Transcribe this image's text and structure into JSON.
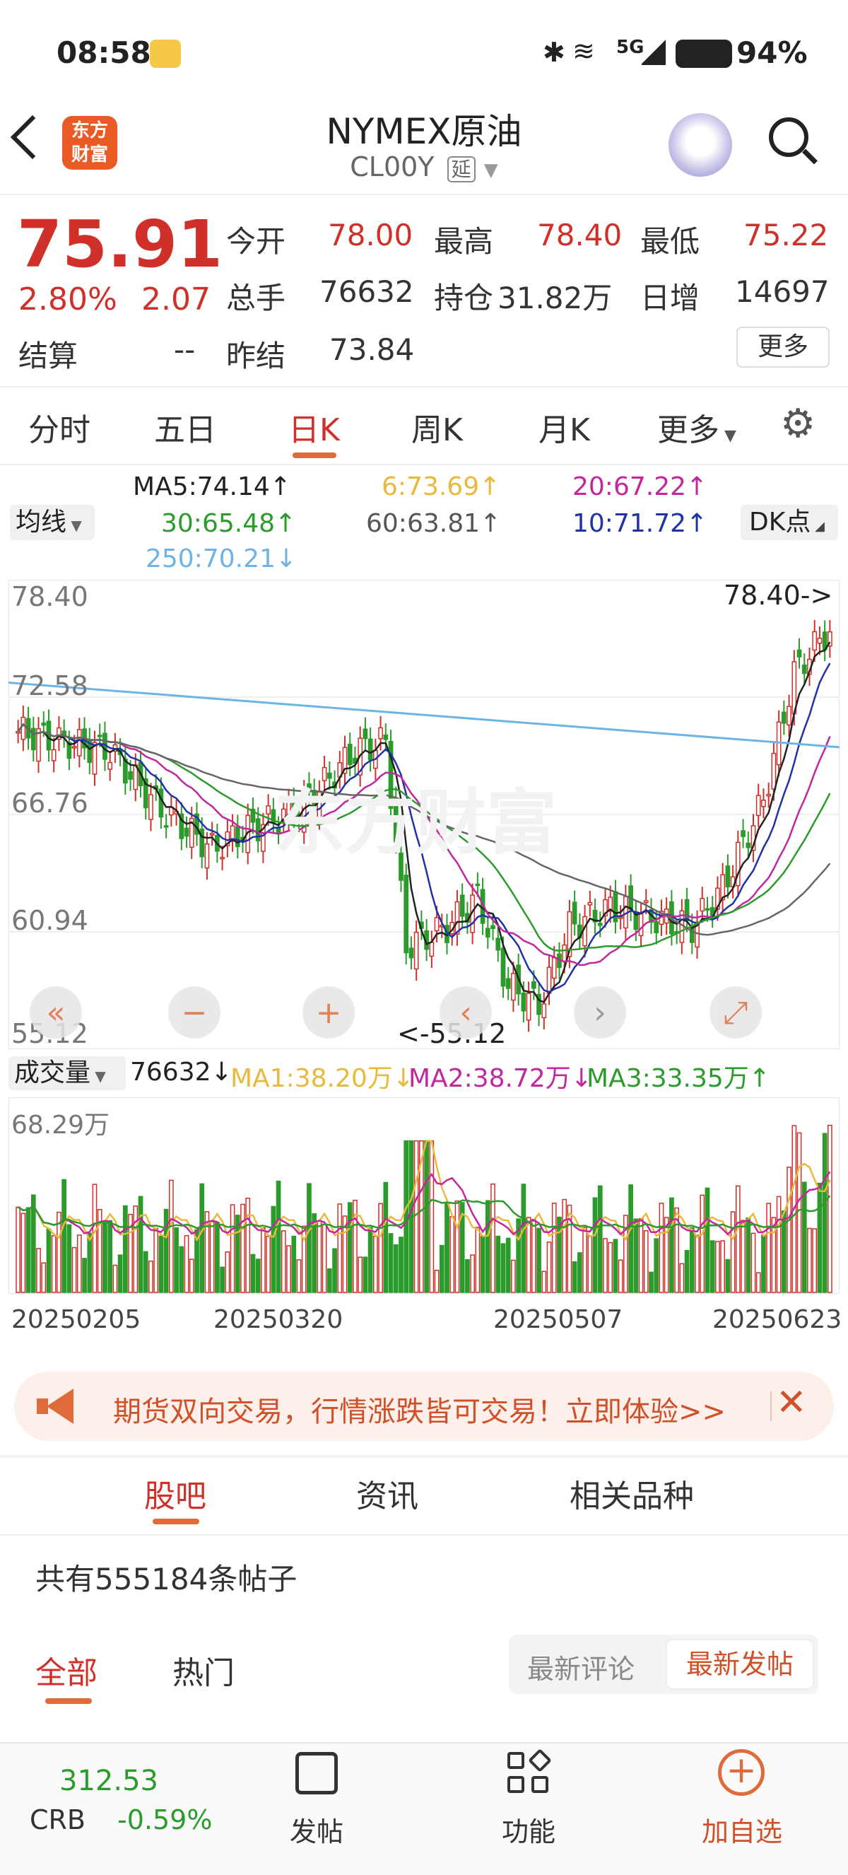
{
  "status": {
    "time": "08:58",
    "signal": "5G",
    "battery": "94%"
  },
  "header": {
    "title": "NYMEX原油",
    "code": "CL00Y",
    "tag": "延",
    "logo_line1": "东方",
    "logo_line2": "财富"
  },
  "quote": {
    "price": "75.91",
    "change_pct": "2.80%",
    "change": "2.07",
    "settle_label": "结算",
    "settle_value": "--",
    "open_label": "今开",
    "open": "78.00",
    "high_label": "最高",
    "high": "78.40",
    "low_label": "最低",
    "low": "75.22",
    "volume_label": "总手",
    "volume": "76632",
    "oi_label": "持仓",
    "oi": "31.82万",
    "daily_label": "日增",
    "daily": "14697",
    "prev_label": "昨结",
    "prev": "73.84",
    "more": "更多"
  },
  "period_tabs": [
    "分时",
    "五日",
    "日K",
    "周K",
    "月K",
    "更多"
  ],
  "ma": {
    "selector": "均线",
    "ma5": "MA5:74.14↑",
    "ma6": "6:73.69↑",
    "ma20": "20:67.22↑",
    "ma30": "30:65.48↑",
    "ma60": "60:63.81↑",
    "ma10": "10:71.72↑",
    "ma250": "250:70.21↓",
    "dk": "DK点"
  },
  "chart": {
    "y_ticks": [
      "78.40",
      "72.58",
      "66.76",
      "60.94",
      "55.12"
    ],
    "high_label": "78.40->",
    "low_label": "<-55.12"
  },
  "volume": {
    "selector": "成交量",
    "value": "76632↓",
    "ma1": "MA1:38.20万↓",
    "ma2": "MA2:38.72万↓",
    "ma3": "MA3:33.35万↑",
    "max": "68.29万",
    "dates": [
      "20250205",
      "20250320",
      "20250507",
      "20250623"
    ]
  },
  "ad": {
    "text": "期货双向交易，行情涨跌皆可交易！立即体验>>"
  },
  "content_tabs": [
    "股吧",
    "资讯",
    "相关品种"
  ],
  "posts": {
    "count": "共有555184条帖子",
    "filters": [
      "全部",
      "热门"
    ],
    "sort": [
      "最新评论",
      "最新发帖"
    ]
  },
  "bottom": {
    "crb_value": "312.53",
    "crb_label": "CRB",
    "crb_change": "-0.59%",
    "post": "发帖",
    "func": "功能",
    "add": "加自选"
  },
  "chart_data": {
    "type": "candlestick",
    "y_range": [
      55.12,
      78.4
    ],
    "x_dates": [
      "20250205",
      "20250320",
      "20250507",
      "20250623"
    ],
    "high": 78.4,
    "low": 55.12,
    "moving_averages": {
      "MA5": 74.14,
      "MA6": 73.69,
      "MA10": 71.72,
      "MA20": 67.22,
      "MA30": 65.48,
      "MA60": 63.81,
      "MA250": 70.21
    },
    "volume_max": "68.29万",
    "volume_ma": {
      "MA1": "38.20万",
      "MA2": "38.72万",
      "MA3": "33.35万"
    }
  }
}
